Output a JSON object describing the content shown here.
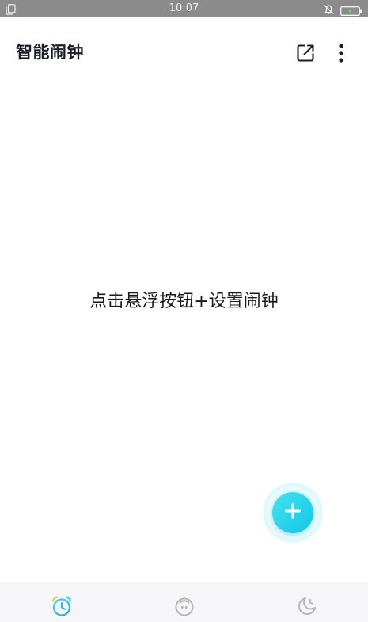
{
  "status_bar": {
    "time": "10:07",
    "left_icon": "copy-icon",
    "right_icons": [
      "bell-off-icon",
      "battery-charging-icon"
    ]
  },
  "app_bar": {
    "title": "智能闹钟",
    "actions": [
      "open-in-new-icon",
      "more-vert-icon"
    ]
  },
  "empty_state": {
    "hint": "点击悬浮按钮+设置闹钟"
  },
  "fab": {
    "icon": "plus-icon"
  },
  "bottom_nav": {
    "items": [
      {
        "icon": "alarm-clock-icon",
        "active": true
      },
      {
        "icon": "timer-icon",
        "active": false
      },
      {
        "icon": "bedtime-icon",
        "active": false
      }
    ]
  },
  "colors": {
    "accent": "#1fcbe6",
    "status_bar_bg": "#8b8b8b",
    "nav_bg": "#f6f6f8",
    "inactive_icon": "#b5b5b5",
    "title_text": "#1c1c2a"
  }
}
